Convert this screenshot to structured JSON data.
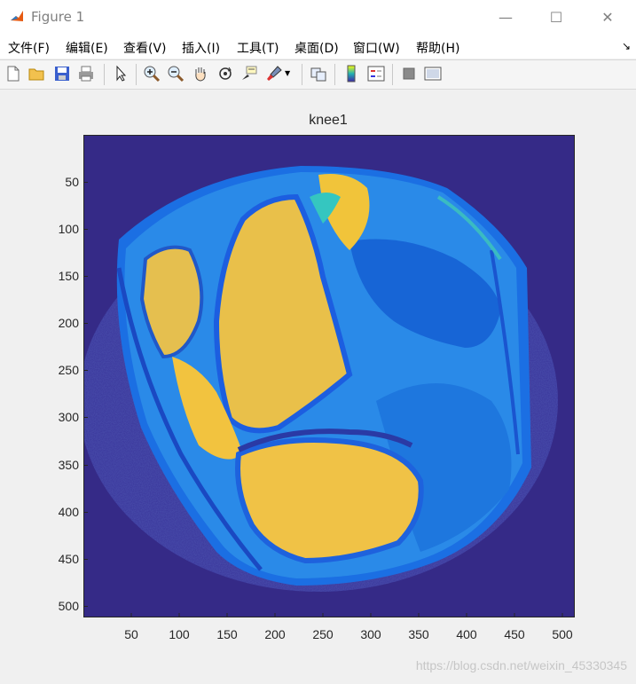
{
  "window": {
    "title": "Figure 1",
    "minimize_glyph": "—",
    "maximize_glyph": "☐",
    "close_glyph": "✕"
  },
  "menu": {
    "items": [
      "文件(F)",
      "编辑(E)",
      "查看(V)",
      "插入(I)",
      "工具(T)",
      "桌面(D)",
      "窗口(W)",
      "帮助(H)"
    ],
    "overflow_glyph": "↘"
  },
  "toolbar": {
    "icons": [
      "new-figure-icon",
      "open-file-icon",
      "save-icon",
      "print-icon",
      "pointer-icon",
      "zoom-in-icon",
      "zoom-out-icon",
      "pan-hand-icon",
      "rotate-3d-icon",
      "data-cursor-icon",
      "brush-icon",
      "link-plot-icon",
      "colorbar-icon",
      "legend-icon",
      "hide-plot-tools-icon",
      "show-plot-tools-icon"
    ]
  },
  "figure": {
    "title": "knee1",
    "colormap": "parula",
    "background_color": "#352a87",
    "watermark": "https://blog.csdn.net/weixin_45330345"
  },
  "chart_data": {
    "type": "heatmap",
    "title": "knee1",
    "xlabel": "",
    "ylabel": "",
    "xlim": [
      0.5,
      512.5
    ],
    "ylim": [
      512.5,
      0.5
    ],
    "y_direction": "reverse",
    "xticks": [
      50,
      100,
      150,
      200,
      250,
      300,
      350,
      400,
      450,
      500
    ],
    "yticks": [
      50,
      100,
      150,
      200,
      250,
      300,
      350,
      400,
      450,
      500
    ],
    "grid": false,
    "colormap": "parula"
  }
}
